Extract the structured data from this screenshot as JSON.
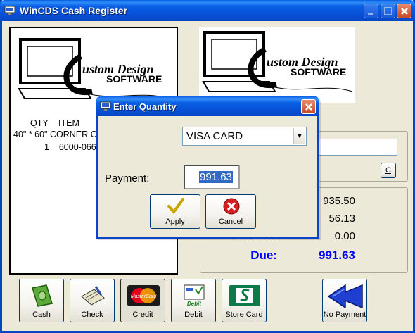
{
  "window": {
    "title": "WinCDS Cash Register"
  },
  "logo": {
    "line1": "ustom Design",
    "line2": "SOFTWARE",
    "initial": "C"
  },
  "receipt": {
    "headers": {
      "qty": "QTY",
      "item": "ITEM"
    },
    "lines": [
      "40\" * 60\" CORNER C",
      "1    6000-066"
    ]
  },
  "customer": {
    "c_button": "C"
  },
  "totals": {
    "subtotal_value": "935.50",
    "tax_value": "56.13",
    "tendered_label": "Tendered:",
    "tendered_value": "0.00",
    "due_label": "Due:",
    "due_value": "991.63"
  },
  "toolbar": {
    "cash": "Cash",
    "check": "Check",
    "credit": "Credit",
    "debit": "Debit",
    "store_card": "Store Card",
    "no_payment": "No Payment"
  },
  "dialog": {
    "title": "Enter Quantity",
    "payment_type": "VISA CARD",
    "payment_label": "Payment:",
    "payment_value": "991.63",
    "apply": "Apply",
    "cancel": "Cancel"
  },
  "icons": {
    "app": "monitor-icon",
    "cash": "money-icon",
    "check": "check-writing-icon",
    "credit": "mastercard-icon",
    "debit": "debit-card-icon",
    "store_card": "store-card-icon",
    "no_payment": "back-arrows-icon",
    "apply": "checkmark-icon",
    "cancel": "red-x-icon"
  },
  "colors": {
    "titlebar": "#0A5FE4",
    "due": "#0000FF",
    "window_bg": "#ECE9D8"
  }
}
